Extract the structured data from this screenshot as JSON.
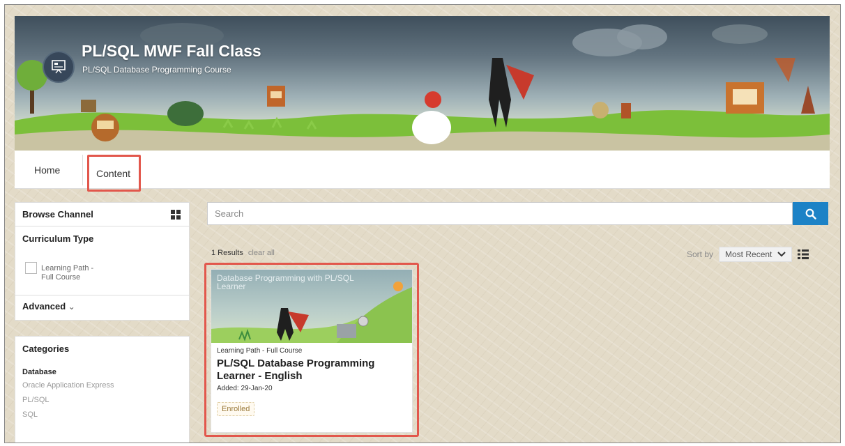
{
  "banner": {
    "title": "PL/SQL MWF Fall Class",
    "subtitle": "PL/SQL Database Programming Course",
    "brand_icon": "presentation-icon"
  },
  "nav": {
    "home": "Home",
    "content": "Content"
  },
  "browse": {
    "title": "Browse Channel",
    "view_icon": "grid-view-icon",
    "curriculum_title": "Curriculum Type",
    "curriculum_option": "Learning Path - Full Course",
    "advanced": "Advanced",
    "advanced_icon": "chevron-down-icon"
  },
  "categories": {
    "title": "Categories",
    "group": "Database",
    "items": [
      "Oracle Application Express",
      "PL/SQL",
      "SQL"
    ]
  },
  "search": {
    "placeholder": "Search",
    "button_icon": "search-icon"
  },
  "results": {
    "count": "1 Results",
    "clear": "clear all"
  },
  "sort": {
    "label": "Sort by",
    "value": "Most Recent",
    "list_icon": "list-view-icon"
  },
  "card": {
    "image_text": "Database Programming with PL/SQL Learner",
    "type": "Learning Path - Full Course",
    "title": "PL/SQL Database Programming Learner - English",
    "added": "Added: 29-Jan-20",
    "status": "Enrolled"
  },
  "colors": {
    "accent": "#1c82c6",
    "highlight": "#e2574c",
    "background": "#e3dbc8"
  }
}
